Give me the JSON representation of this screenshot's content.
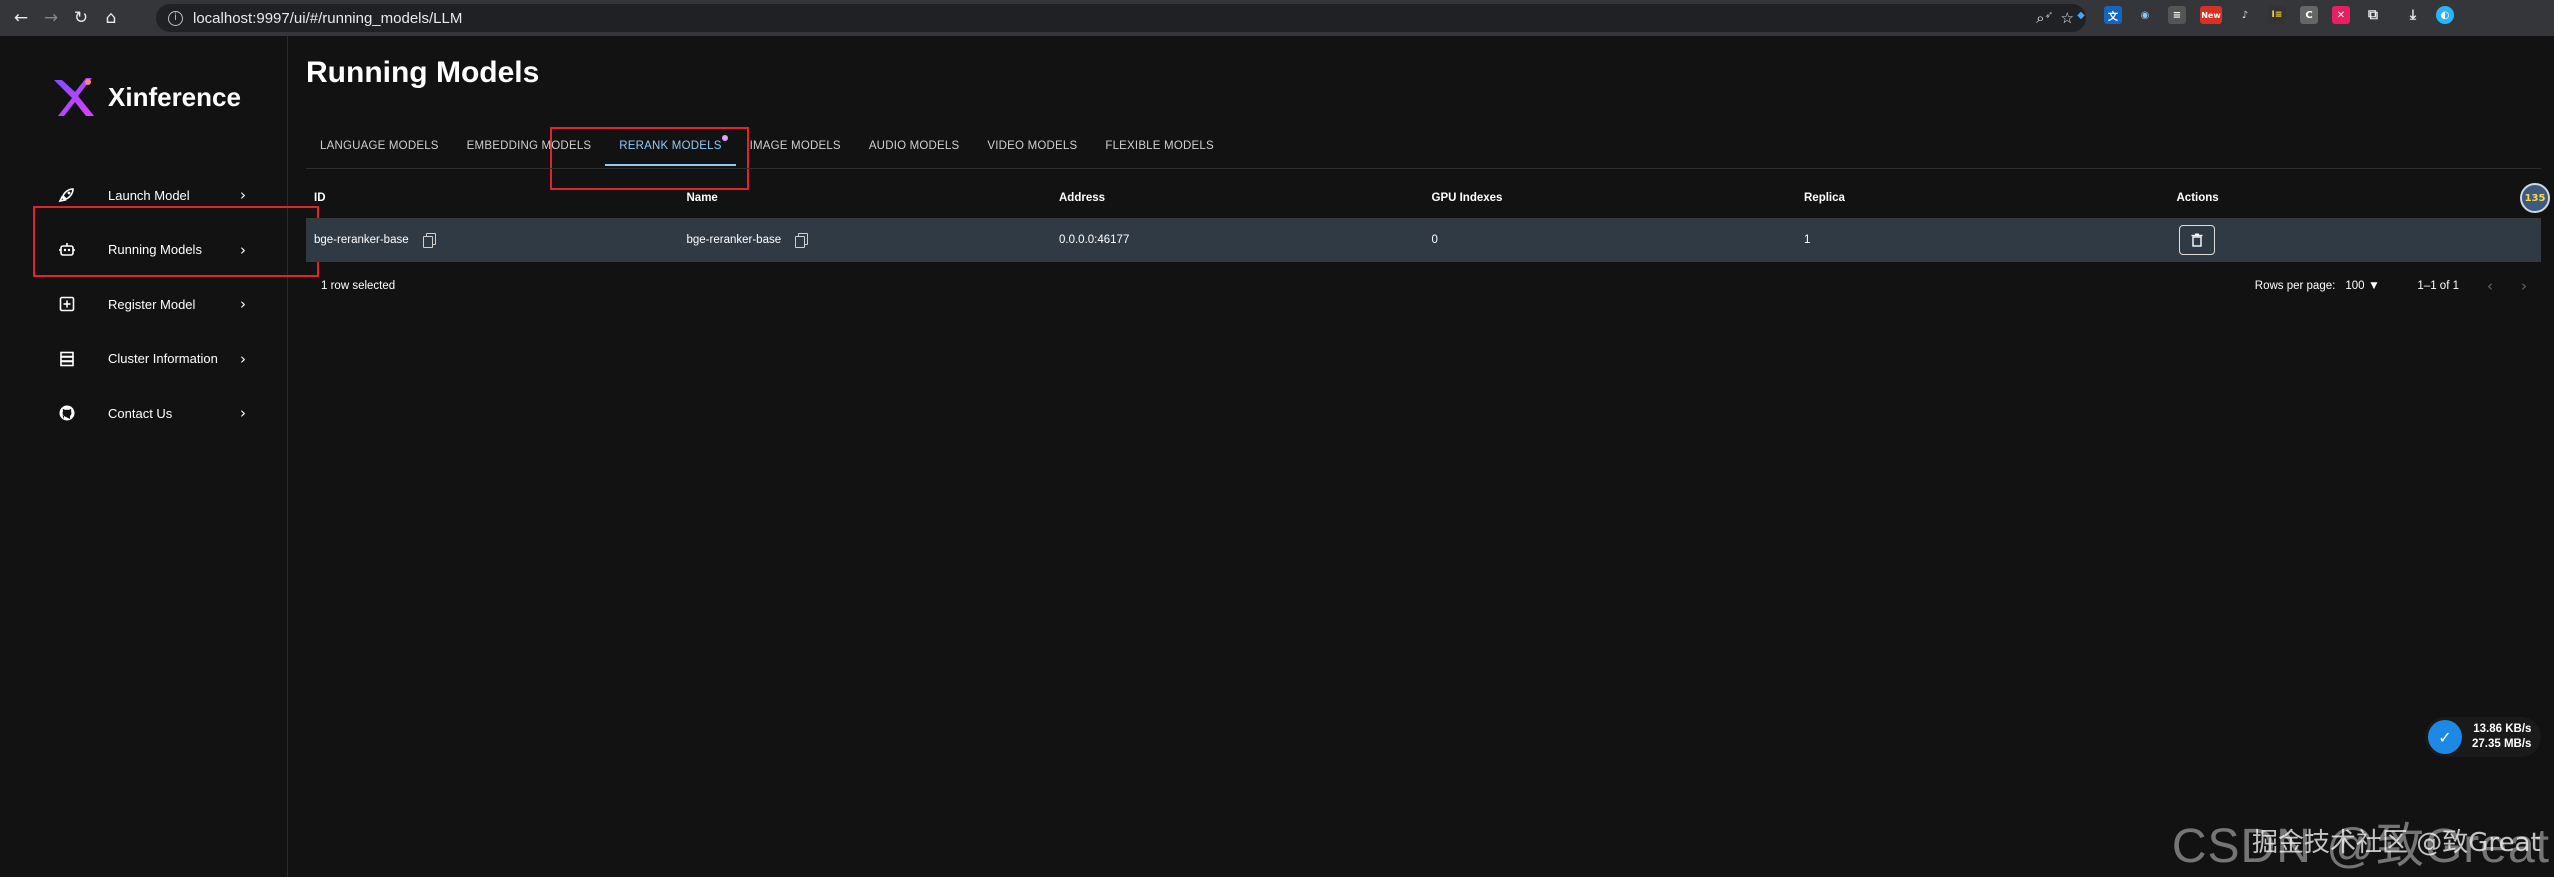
{
  "browser": {
    "url": "localhost:9997/ui/#/running_models/LLM",
    "extensions": [
      "fox-icon",
      "gem-icon",
      "translate-icon",
      "circle-ext-icon",
      "list-ext-icon",
      "new-ext-icon",
      "bird-ext-icon",
      "id-ext-icon",
      "c-ext-icon",
      "x-ext-icon",
      "puzzle-icon",
      "download-icon",
      "globe-icon"
    ],
    "new_badge": "New",
    "extension_labels": {
      "id": "I≡",
      "c": "C",
      "x": "✕"
    }
  },
  "sidebar": {
    "brand": "Xinference",
    "items": [
      {
        "label": "Launch Model",
        "icon": "rocket-icon"
      },
      {
        "label": "Running Models",
        "icon": "robot-icon"
      },
      {
        "label": "Register Model",
        "icon": "add-box-icon"
      },
      {
        "label": "Cluster Information",
        "icon": "storage-icon"
      },
      {
        "label": "Contact Us",
        "icon": "github-icon"
      }
    ]
  },
  "main": {
    "title": "Running Models",
    "tabs": [
      {
        "label": "LANGUAGE MODELS",
        "active": false
      },
      {
        "label": "EMBEDDING MODELS",
        "active": false
      },
      {
        "label": "RERANK MODELS",
        "active": true
      },
      {
        "label": "IMAGE MODELS",
        "active": false
      },
      {
        "label": "AUDIO MODELS",
        "active": false
      },
      {
        "label": "VIDEO MODELS",
        "active": false
      },
      {
        "label": "FLEXIBLE MODELS",
        "active": false
      }
    ],
    "table": {
      "columns": [
        "ID",
        "Name",
        "Address",
        "GPU Indexes",
        "Replica",
        "Actions"
      ],
      "rows": [
        {
          "id": "bge-reranker-base",
          "name": "bge-reranker-base",
          "address": "0.0.0.0:46177",
          "gpu_indexes": "0",
          "replica": "1"
        }
      ],
      "footer": {
        "selected_text": "1 row selected",
        "rows_per_page_label": "Rows per page:",
        "rows_per_page_value": "100",
        "range_text": "1–1 of 1"
      }
    }
  },
  "overlay": {
    "avatar_text": "135",
    "upload_speed": "13.86 KB/s",
    "download_speed": "27.35 MB/s",
    "watermark": "CSDN @致Great",
    "watermark_sub": "掘金技术社区 @致Great"
  },
  "colors": {
    "accent": "#90caf9",
    "highlight_box": "#e0242e",
    "selected_row": "#2f3a45",
    "background": "#121212"
  }
}
